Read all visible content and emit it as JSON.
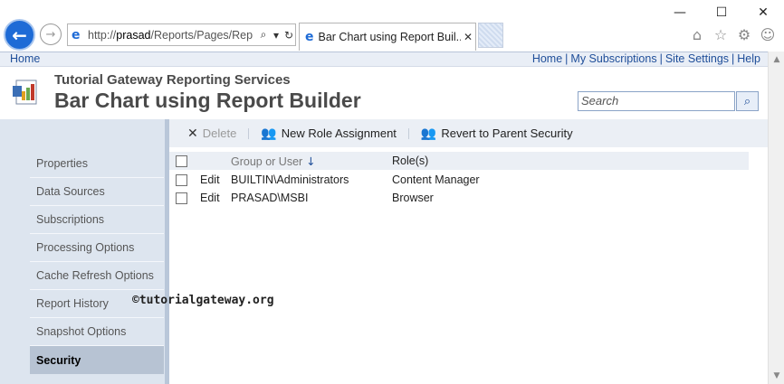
{
  "browser": {
    "window_controls": [
      "—",
      "☐",
      "✕"
    ],
    "address_url_prefix": "http://",
    "address_url_host": "prasad",
    "address_url_rest": "/Reports/Pages/Rep",
    "tab_title": "Bar Chart using Report Buil...",
    "tab_close": "✕"
  },
  "topnav": {
    "home": "Home",
    "links": [
      "Home",
      "My Subscriptions",
      "Site Settings",
      "Help"
    ],
    "separator": "|"
  },
  "header": {
    "site_title": "Tutorial Gateway Reporting Services",
    "page_title": "Bar Chart using Report Builder",
    "search_placeholder": "Search"
  },
  "sidebar": {
    "items": [
      {
        "label": "Properties",
        "active": false
      },
      {
        "label": "Data Sources",
        "active": false
      },
      {
        "label": "Subscriptions",
        "active": false
      },
      {
        "label": "Processing Options",
        "active": false
      },
      {
        "label": "Cache Refresh Options",
        "active": false
      },
      {
        "label": "Report History",
        "active": false
      },
      {
        "label": "Snapshot Options",
        "active": false
      },
      {
        "label": "Security",
        "active": true
      }
    ]
  },
  "toolbar": {
    "delete_label": "Delete",
    "new_role_label": "New Role Assignment",
    "revert_label": "Revert to Parent Security"
  },
  "grid": {
    "col_group": "Group or User",
    "col_roles": "Role(s)",
    "rows": [
      {
        "action": "Edit",
        "user": "BUILTIN\\Administrators",
        "role": "Content Manager"
      },
      {
        "action": "Edit",
        "user": "PRASAD\\MSBI",
        "role": "Browser"
      }
    ]
  },
  "watermark": "©tutorialgateway.org",
  "colors": {
    "link": "#1f4e99",
    "sidebar_bg": "#dde5ef",
    "sidebar_active": "#b7c3d3",
    "toolbar_bg": "#ebeff5",
    "browser_back": "#1e6bd6"
  }
}
